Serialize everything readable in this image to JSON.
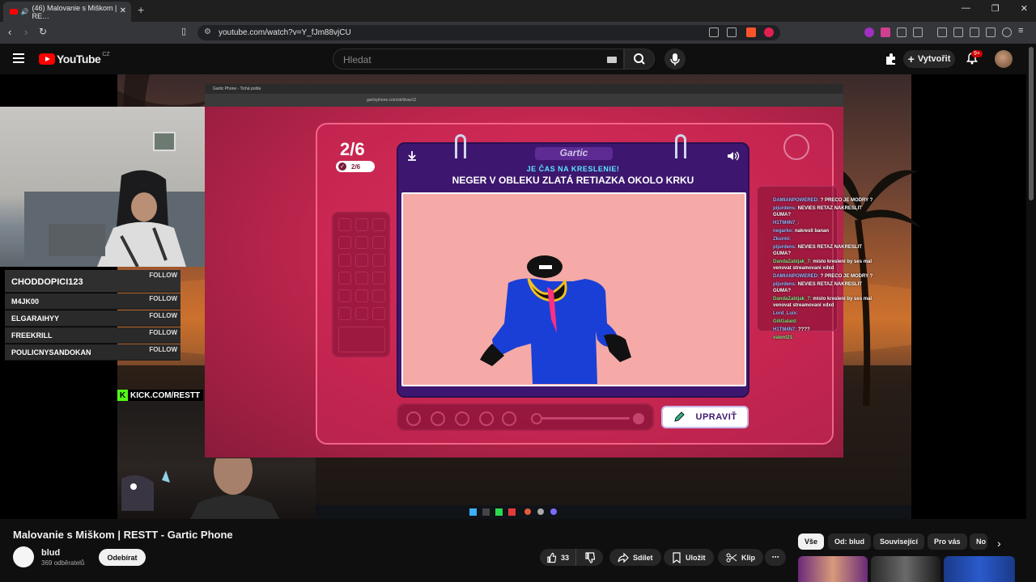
{
  "browser": {
    "tab_title": "(46) Malovanie s Miškom | RE…",
    "url": "youtube.com/watch?v=Y_fJm88vjCU"
  },
  "youtube": {
    "logo_text": "YouTube",
    "region": "CZ",
    "search_placeholder": "Hledat",
    "create_label": "Vytvořit",
    "notif_count": "9+"
  },
  "stream": {
    "kick_label": "KICK.COM/RESTT",
    "follows": [
      {
        "name": "CHODDOPICI123",
        "btn": "FOLLOW"
      },
      {
        "name": "M4JK00",
        "btn": "FOLLOW"
      },
      {
        "name": "ELGARAIHYY",
        "btn": "FOLLOW"
      },
      {
        "name": "FREEKRILL",
        "btn": "FOLLOW"
      },
      {
        "name": "POULICNYSANDOKAN",
        "btn": "FOLLOW"
      }
    ],
    "inner_tab": "Gartic Phone - Tichá pošta",
    "inner_url": "garticphone.com/sk/draw12"
  },
  "gartic": {
    "round": "2/6",
    "round_pill": "2/6",
    "logo": "Gartic",
    "subtitle": "JE ČAS NA KRESLENIE!",
    "prompt": "NEGER V OBLEKU ZLATÁ RETIAZKA OKOLO KRKU",
    "edit_button": "UPRAVIŤ"
  },
  "chat": [
    {
      "user": "DAMIANPOWERED:",
      "msg": "? PRECO JE MODRY ?",
      "cls": "u"
    },
    {
      "user": "pijurdens:",
      "msg": "NEVIES RETAZ NAKRESLIT GUMA?",
      "cls": "u"
    },
    {
      "user": "H1TM4N7_:",
      "msg": "",
      "cls": "u"
    },
    {
      "user": "negarko:",
      "msg": "nakresli banan",
      "cls": "u"
    },
    {
      "user": "Zkurmi:",
      "msg": "",
      "cls": "u"
    },
    {
      "user": "pijurdens:",
      "msg": "NEVIES RETAZ NAKRESLIT GUMA?",
      "cls": "u"
    },
    {
      "user": "DandaZabijak_7:",
      "msg": "misto kresleni by ses mal venovat streamovani xdxd",
      "cls": "g"
    },
    {
      "user": "DAMIANPOWERED:",
      "msg": "? PRECO JE MODRY ?",
      "cls": "u"
    },
    {
      "user": "pijurdens:",
      "msg": "NEVIES RETAZ NAKRESLIT GUMA?",
      "cls": "u"
    },
    {
      "user": "DandaZabijak_7:",
      "msg": "misto kresleni by ses mal venovat streamovani xdxd",
      "cls": "g"
    },
    {
      "user": "Lord_Luix:",
      "msg": "",
      "cls": "u"
    },
    {
      "user": "GiliGalaid:",
      "msg": "",
      "cls": "g"
    },
    {
      "user": "H1TM4N7:",
      "msg": "????",
      "cls": "u"
    },
    {
      "user": "valent21:",
      "msg": "",
      "cls": "g"
    }
  ],
  "video": {
    "title": "Malovanie s Miškom | RESTT - Gartic Phone",
    "channel": "blud",
    "subs": "369 odběratelů",
    "subscribe": "Odebírat",
    "likes": "33",
    "share": "Sdílet",
    "save": "Uložit",
    "clip": "Klip"
  },
  "chips": [
    "Vše",
    "Od: blud",
    "Související",
    "Pro vás",
    "No"
  ]
}
